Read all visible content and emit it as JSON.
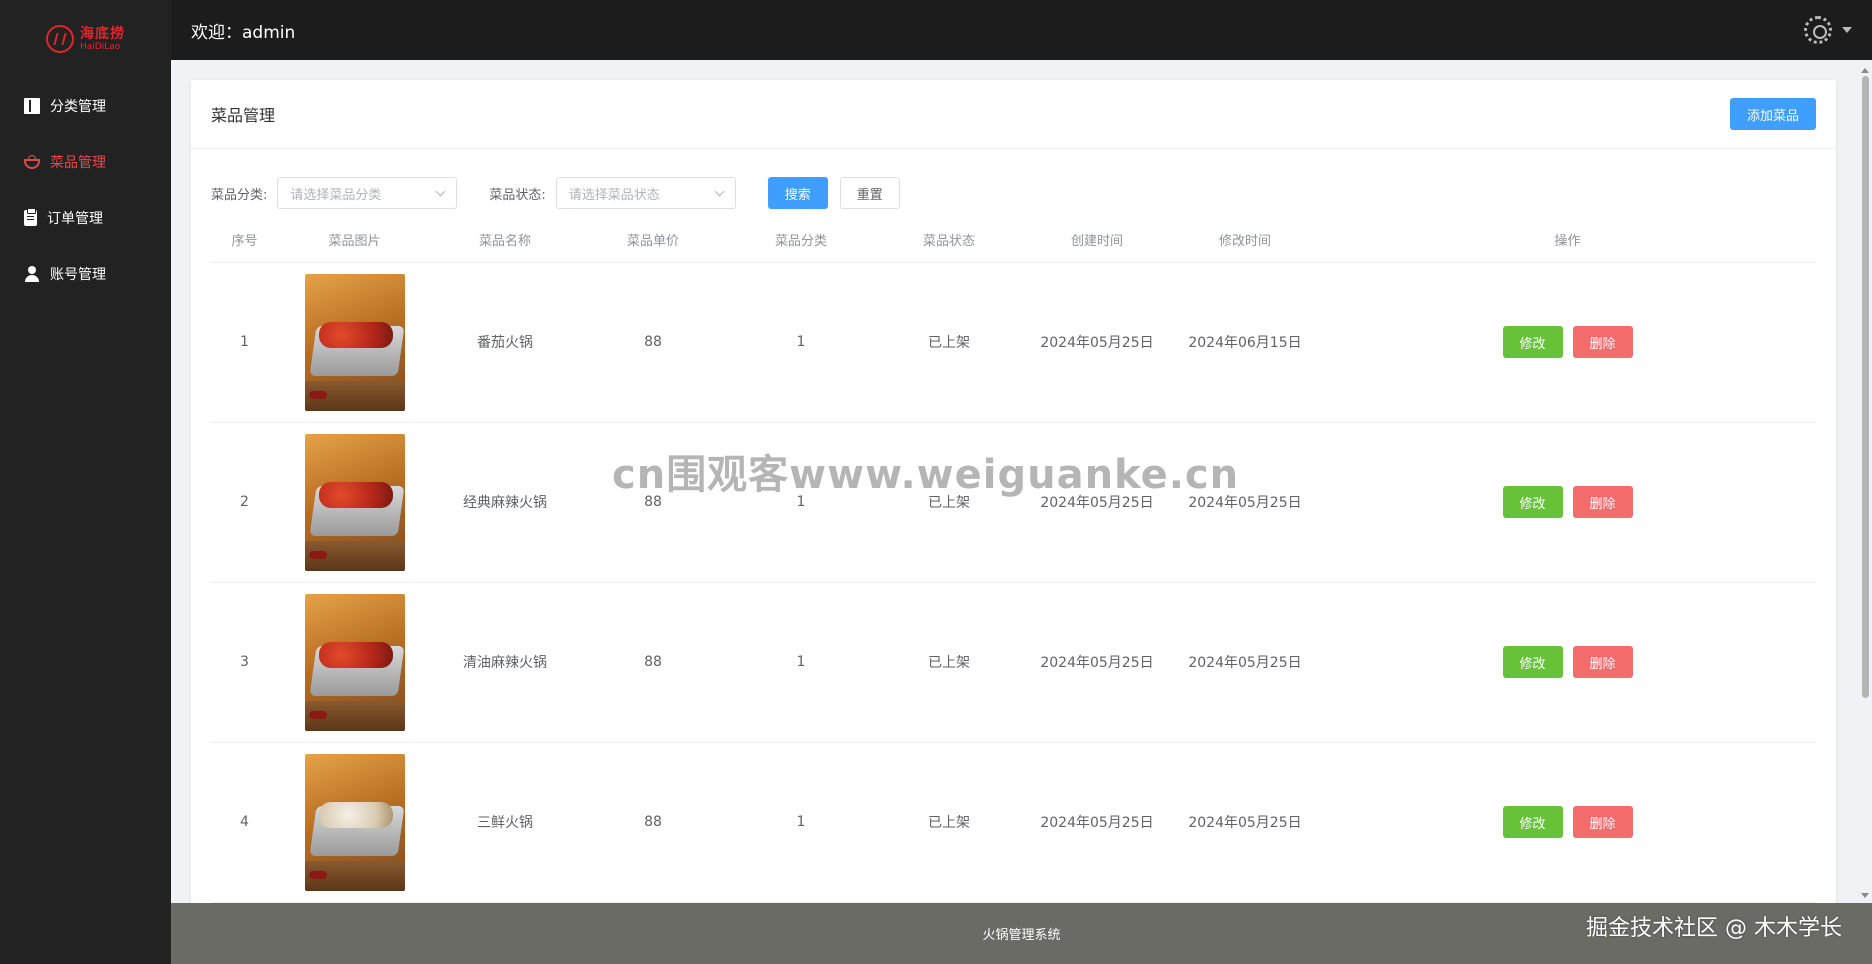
{
  "logo": {
    "cn": "海底捞",
    "en": "HaiDiLao"
  },
  "sidebar": {
    "items": [
      {
        "label": "分类管理",
        "icon": "book-icon"
      },
      {
        "label": "菜品管理",
        "icon": "bowl-icon",
        "active": true
      },
      {
        "label": "订单管理",
        "icon": "clipboard-icon"
      },
      {
        "label": "账号管理",
        "icon": "user-icon"
      }
    ]
  },
  "header": {
    "welcome": "欢迎：admin"
  },
  "card": {
    "title": "菜品管理",
    "add_button": "添加菜品"
  },
  "filters": {
    "category_label": "菜品分类:",
    "category_placeholder": "请选择菜品分类",
    "status_label": "菜品状态:",
    "status_placeholder": "请选择菜品状态",
    "search_button": "搜索",
    "reset_button": "重置"
  },
  "table": {
    "columns": [
      "序号",
      "菜品图片",
      "菜品名称",
      "菜品单价",
      "菜品分类",
      "菜品状态",
      "创建时间",
      "修改时间",
      "操作"
    ],
    "rows": [
      {
        "index": "1",
        "name": "番茄火锅",
        "price": "88",
        "category": "1",
        "status": "已上架",
        "created": "2024年05月25日",
        "modified": "2024年06月15日"
      },
      {
        "index": "2",
        "name": "经典麻辣火锅",
        "price": "88",
        "category": "1",
        "status": "已上架",
        "created": "2024年05月25日",
        "modified": "2024年05月25日"
      },
      {
        "index": "3",
        "name": "清油麻辣火锅",
        "price": "88",
        "category": "1",
        "status": "已上架",
        "created": "2024年05月25日",
        "modified": "2024年05月25日"
      },
      {
        "index": "4",
        "name": "三鲜火锅",
        "price": "88",
        "category": "1",
        "status": "已上架",
        "created": "2024年05月25日",
        "modified": "2024年05月25日"
      }
    ],
    "edit_label": "修改",
    "delete_label": "删除"
  },
  "footer": {
    "text": "火锅管理系统"
  },
  "watermark": "cn围观客www.weiguanke.cn",
  "credit": "掘金技术社区 @ 木木学长",
  "colors": {
    "sidebar": "#222222",
    "header": "#1c1c1c",
    "accent": "#409eff",
    "active_menu": "#e24a4a",
    "success": "#67c23a",
    "danger": "#f56c6c",
    "footer": "#6b6b66"
  }
}
